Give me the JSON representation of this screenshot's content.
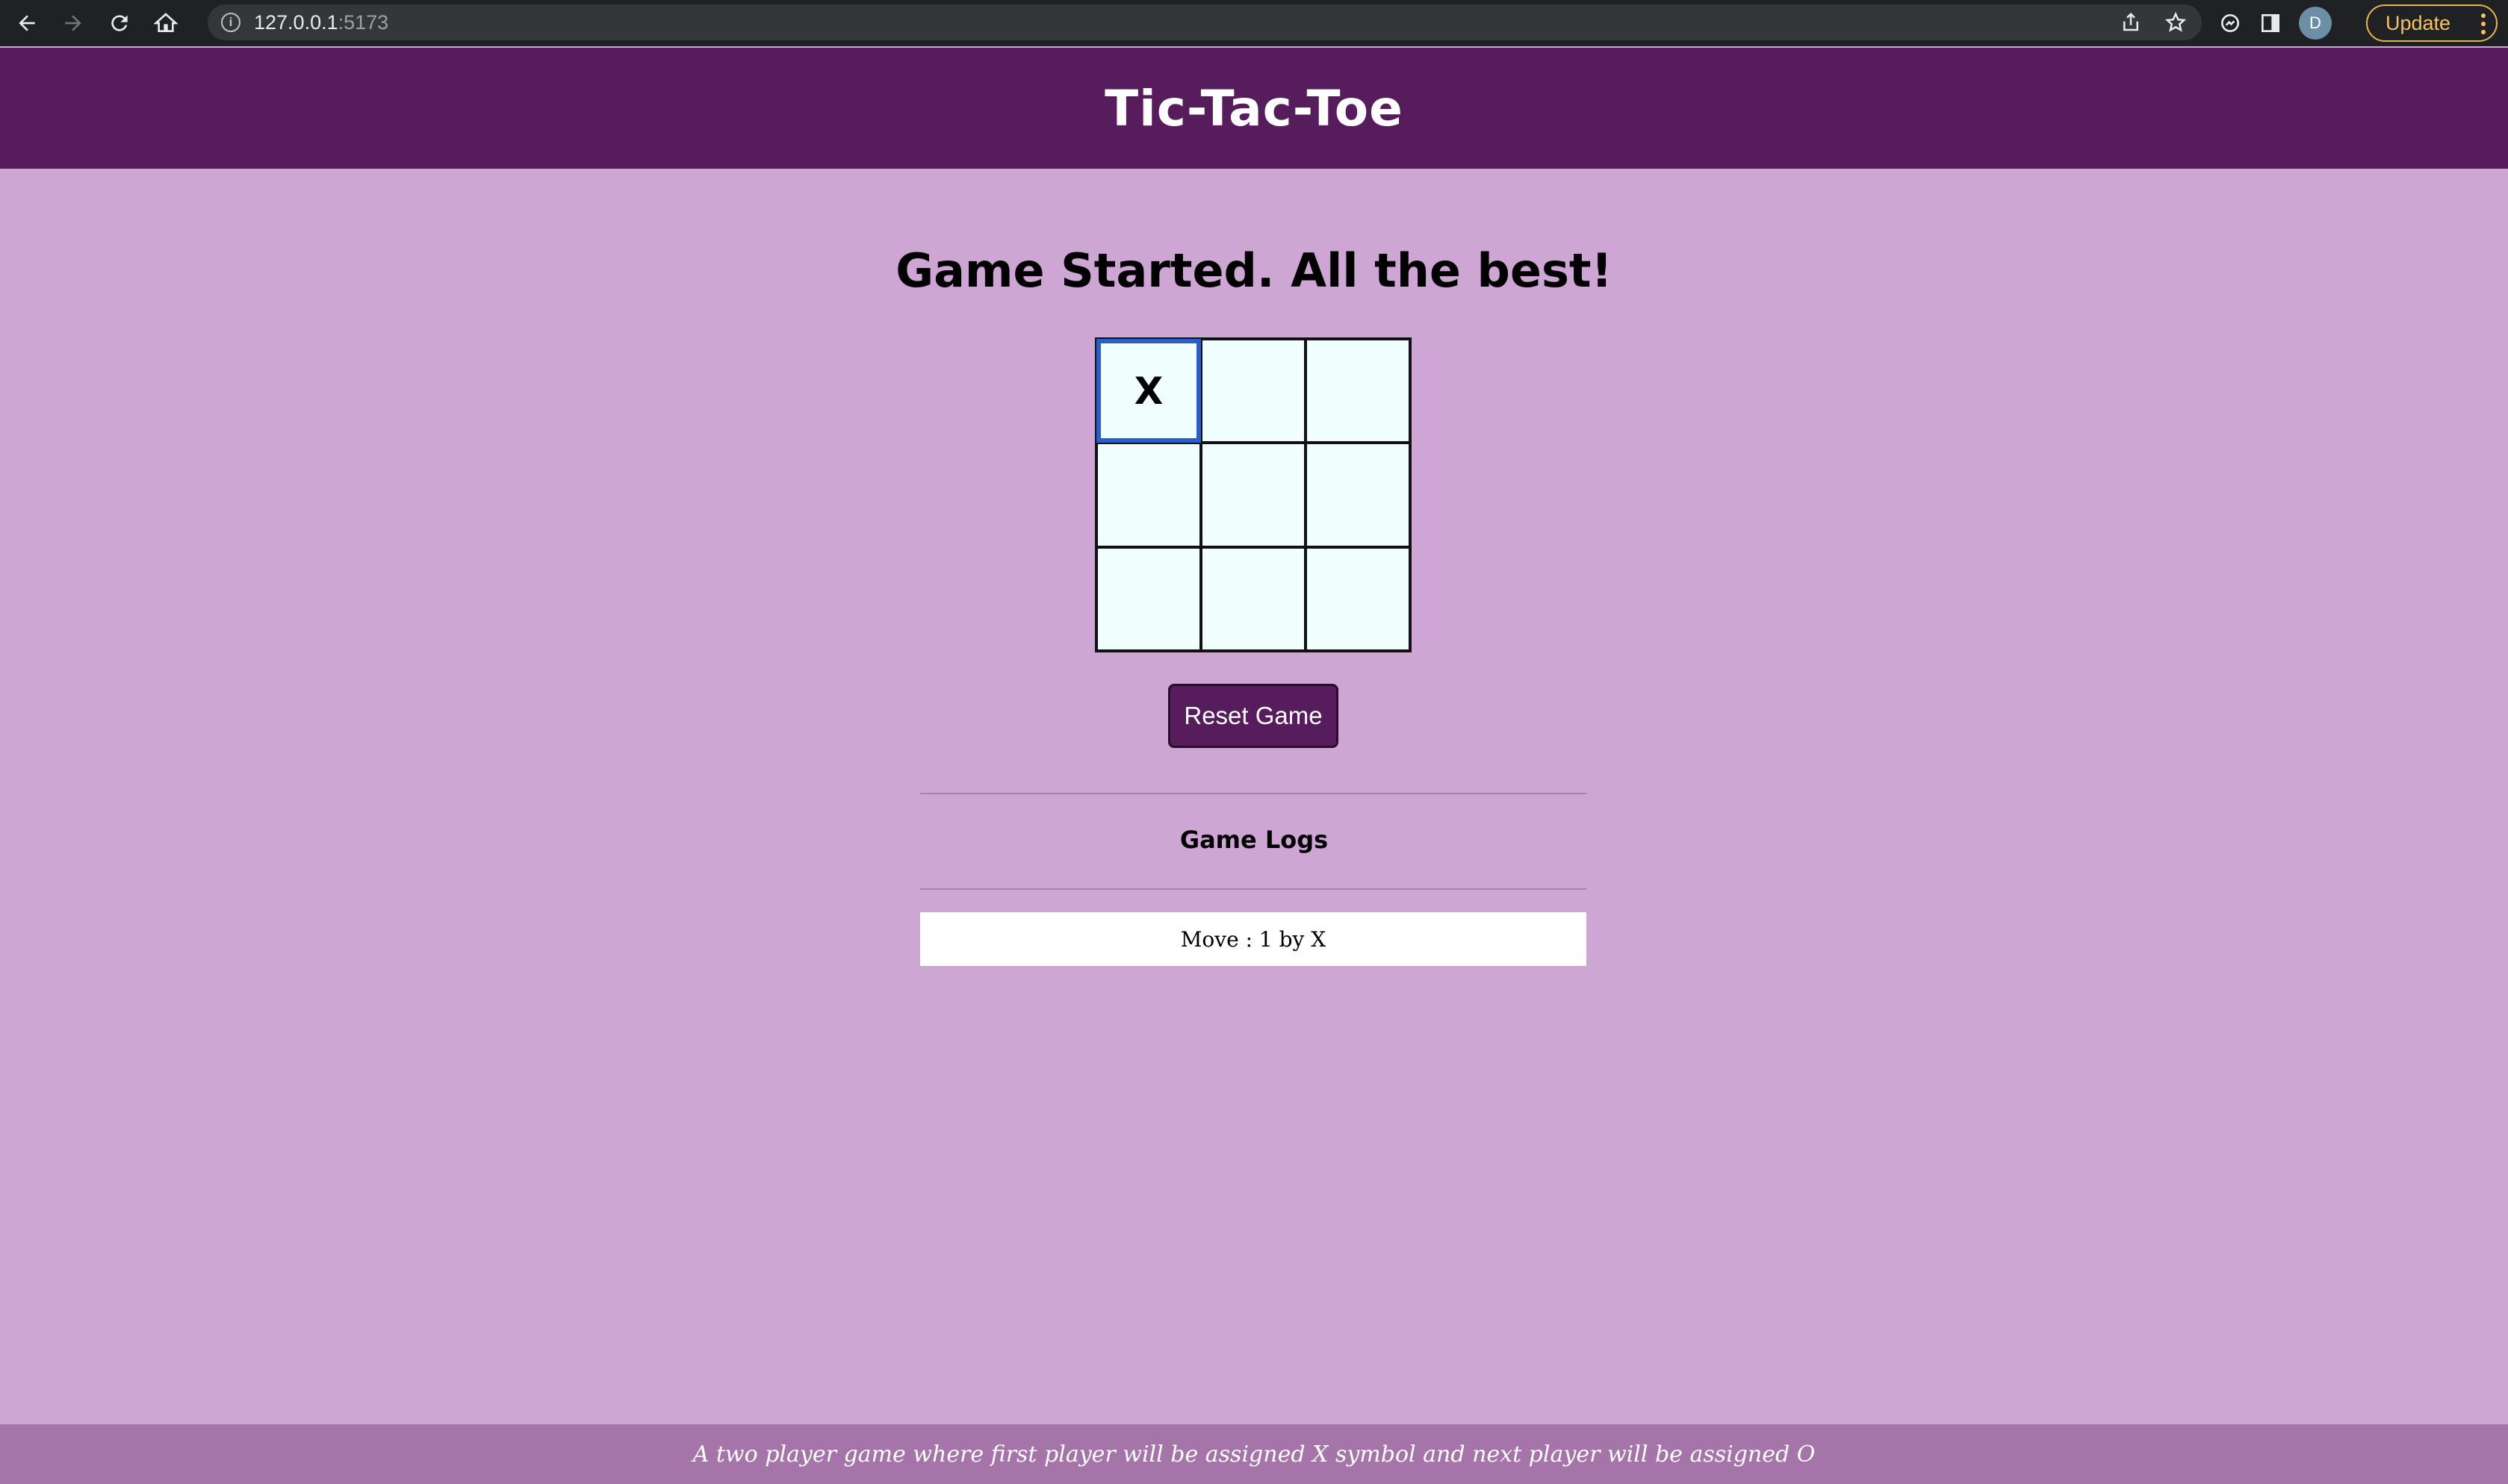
{
  "browser": {
    "url_host": "127.0.0.1",
    "url_port": ":5173",
    "profile_initial": "D",
    "update_label": "Update"
  },
  "header": {
    "title": "Tic-Tac-Toe"
  },
  "game": {
    "status": "Game Started. All the best!",
    "board": [
      "X",
      "",
      "",
      "",
      "",
      "",
      "",
      "",
      ""
    ],
    "reset_label": "Reset Game"
  },
  "logs": {
    "title": "Game Logs",
    "entries": [
      "Move : 1 by X"
    ]
  },
  "footer": {
    "text": "A two player game where first player will be assigned X symbol and next player will be assigned O"
  },
  "colors": {
    "header_bg": "#561c5c",
    "page_bg": "#cda6d4",
    "cell_bg": "#f0fffe",
    "footer_bg": "#a575a9"
  }
}
